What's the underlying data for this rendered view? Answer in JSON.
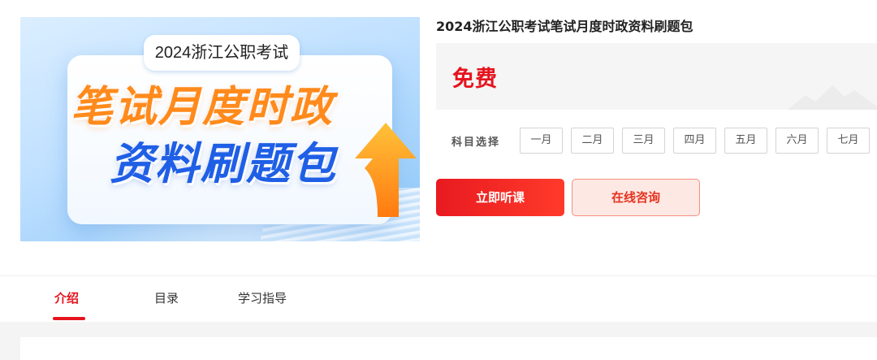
{
  "banner": {
    "tag": "2024浙江公职考试",
    "line1": "笔试月度时政",
    "line2": "资料刷题包"
  },
  "course": {
    "title": "2024浙江公职考试笔试月度时政资料刷题包",
    "price": "免费"
  },
  "subject": {
    "label": "科目选择",
    "months": [
      "一月",
      "二月",
      "三月",
      "四月",
      "五月",
      "六月",
      "七月"
    ]
  },
  "actions": {
    "primary": "立即听课",
    "secondary": "在线咨询"
  },
  "tabs": [
    {
      "label": "介绍",
      "active": true
    },
    {
      "label": "目录",
      "active": false
    },
    {
      "label": "学习指导",
      "active": false
    }
  ],
  "colors": {
    "accent": "#e5141e",
    "banner_orange": "#ff8a1c",
    "banner_blue": "#1f5fe6"
  }
}
